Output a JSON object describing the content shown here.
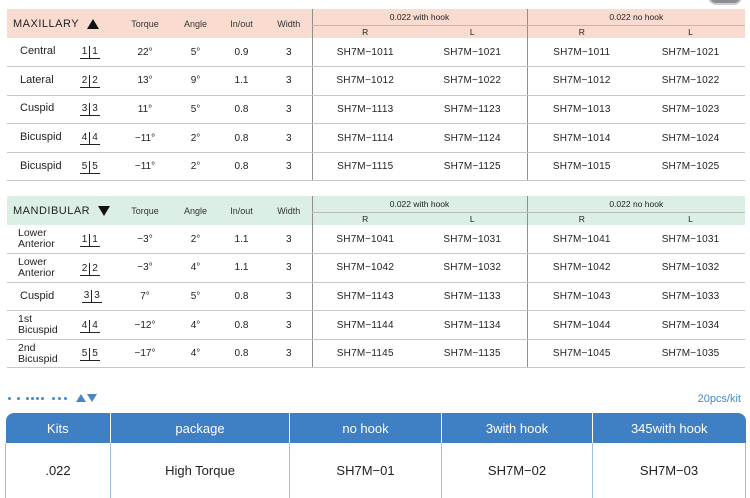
{
  "maxillary": {
    "title": "MAXILLARY",
    "headers": {
      "torque": "Torque",
      "angle": "Angle",
      "inout": "In/out",
      "width": "Width"
    },
    "group_with_hook": "0.022 with hook",
    "group_no_hook": "0.022 no hook",
    "r": "R",
    "l": "L",
    "rows": [
      {
        "tooth": "Central",
        "q": [
          "1",
          "1"
        ],
        "torque": "22°",
        "angle": "5°",
        "inout": "0.9",
        "width": "3",
        "wh_r": "SH7M−1011",
        "wh_l": "SH7M−1021",
        "nh_r": "SH7M−1011",
        "nh_l": "SH7M−1021"
      },
      {
        "tooth": "Lateral",
        "q": [
          "2",
          "2"
        ],
        "torque": "13°",
        "angle": "9°",
        "inout": "1.1",
        "width": "3",
        "wh_r": "SH7M−1012",
        "wh_l": "SH7M−1022",
        "nh_r": "SH7M−1012",
        "nh_l": "SH7M−1022"
      },
      {
        "tooth": "Cuspid",
        "q": [
          "3",
          "3"
        ],
        "torque": "11°",
        "angle": "5°",
        "inout": "0.8",
        "width": "3",
        "wh_r": "SH7M−1113",
        "wh_l": "SH7M−1123",
        "nh_r": "SH7M−1013",
        "nh_l": "SH7M−1023"
      },
      {
        "tooth": "Bicuspid",
        "q": [
          "4",
          "4"
        ],
        "torque": "−11°",
        "angle": "2°",
        "inout": "0.8",
        "width": "3",
        "wh_r": "SH7M−1114",
        "wh_l": "SH7M−1124",
        "nh_r": "SH7M−1014",
        "nh_l": "SH7M−1024"
      },
      {
        "tooth": "Bicuspid",
        "q": [
          "5",
          "5"
        ],
        "torque": "−11°",
        "angle": "2°",
        "inout": "0.8",
        "width": "3",
        "wh_r": "SH7M−1115",
        "wh_l": "SH7M−1125",
        "nh_r": "SH7M−1015",
        "nh_l": "SH7M−1025"
      }
    ]
  },
  "mandibular": {
    "title": "MANDIBULAR",
    "headers": {
      "torque": "Torque",
      "angle": "Angle",
      "inout": "In/out",
      "width": "Width"
    },
    "group_with_hook": "0.022 with hook",
    "group_no_hook": "0.022 no hook",
    "r": "R",
    "l": "L",
    "rows": [
      {
        "tooth_1": "Lower",
        "tooth_2": "Anterior",
        "q": [
          "1",
          "1"
        ],
        "torque": "−3°",
        "angle": "2°",
        "inout": "1.1",
        "width": "3",
        "wh_r": "SH7M−1041",
        "wh_l": "SH7M−1031",
        "nh_r": "SH7M−1041",
        "nh_l": "SH7M−1031"
      },
      {
        "tooth_1": "Lower",
        "tooth_2": "Anterior",
        "q": [
          "2",
          "2"
        ],
        "torque": "−3°",
        "angle": "4°",
        "inout": "1.1",
        "width": "3",
        "wh_r": "SH7M−1042",
        "wh_l": "SH7M−1032",
        "nh_r": "SH7M−1042",
        "nh_l": "SH7M−1032"
      },
      {
        "tooth_1": "Cuspid",
        "tooth_2": "",
        "q": [
          "3",
          "3"
        ],
        "torque": "7°",
        "angle": "5°",
        "inout": "0.8",
        "width": "3",
        "wh_r": "SH7M−1143",
        "wh_l": "SH7M−1133",
        "nh_r": "SH7M−1043",
        "nh_l": "SH7M−1033"
      },
      {
        "tooth_1": "1st",
        "tooth_2": "Bicuspid",
        "q": [
          "4",
          "4"
        ],
        "torque": "−12°",
        "angle": "4°",
        "inout": "0.8",
        "width": "3",
        "wh_r": "SH7M−1144",
        "wh_l": "SH7M−1134",
        "nh_r": "SH7M−1044",
        "nh_l": "SH7M−1034"
      },
      {
        "tooth_1": "2nd",
        "tooth_2": "Bicuspid",
        "q": [
          "5",
          "5"
        ],
        "torque": "−17°",
        "angle": "4°",
        "inout": "0.8",
        "width": "3",
        "wh_r": "SH7M−1145",
        "wh_l": "SH7M−1135",
        "nh_r": "SH7M−1045",
        "nh_l": "SH7M−1035"
      }
    ]
  },
  "pcs_per_kit": "20pcs/kit",
  "kits": {
    "headers": [
      "Kits",
      "package",
      "no hook",
      "3with hook",
      "345with hook"
    ],
    "row": [
      ".022",
      "High Torque",
      "SH7M−01",
      "SH7M−02",
      "SH7M−03"
    ]
  },
  "colors": {
    "maxillary_header_bg": "#f9dccf",
    "mandibular_header_bg": "#dcefe4",
    "accent_blue": "#3f7fc4"
  },
  "icons": [
    "triangle-up-icon",
    "triangle-down-icon",
    "blue-up-triangle-icon",
    "blue-down-triangle-icon"
  ]
}
